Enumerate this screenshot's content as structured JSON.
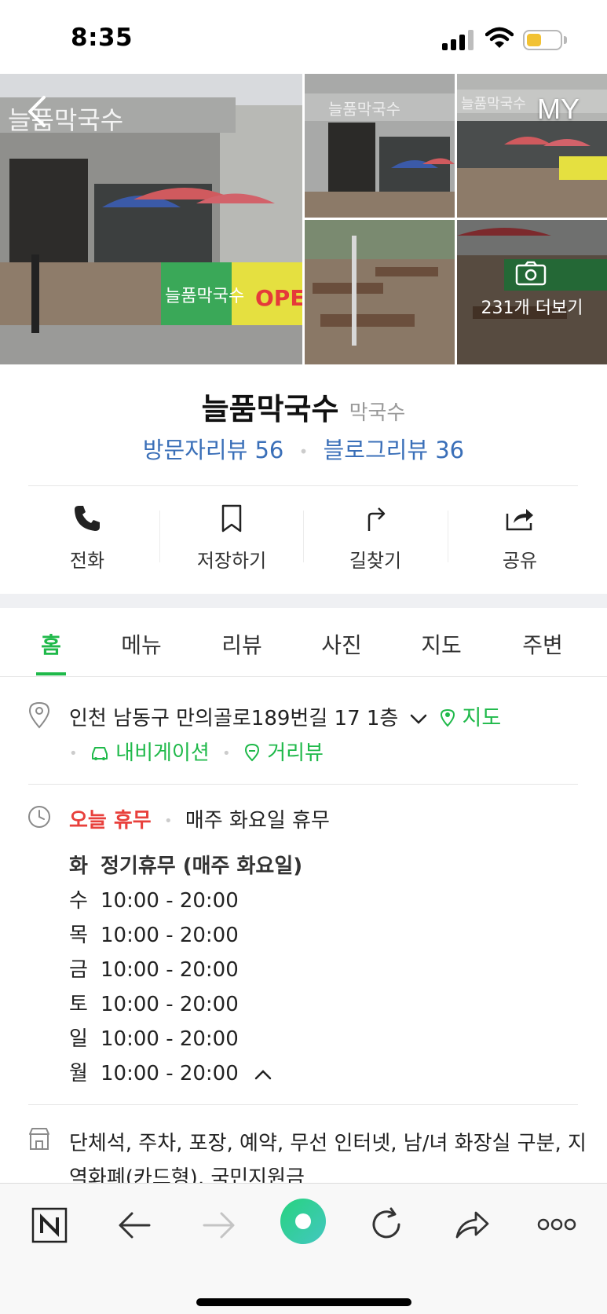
{
  "status_bar": {
    "time": "8:35",
    "battery_level": 0.45,
    "battery_color": "#f2c233",
    "icons": [
      "signal-icon",
      "wifi-icon",
      "battery-icon"
    ]
  },
  "header": {
    "back_icon": "chevron-left-icon",
    "my_label": "MY"
  },
  "photos": {
    "more_label": "231개 더보기",
    "more_icon": "camera-icon"
  },
  "place": {
    "name": "늘품막국수",
    "category": "막국수",
    "visitor_reviews": "방문자리뷰 56",
    "blog_reviews": "블로그리뷰 36"
  },
  "actions": [
    {
      "label": "전화",
      "icon": "phone-icon"
    },
    {
      "label": "저장하기",
      "icon": "bookmark-icon"
    },
    {
      "label": "길찾기",
      "icon": "directions-icon"
    },
    {
      "label": "공유",
      "icon": "share-icon"
    }
  ],
  "tabs": [
    {
      "label": "홈",
      "active": true
    },
    {
      "label": "메뉴",
      "active": false
    },
    {
      "label": "리뷰",
      "active": false
    },
    {
      "label": "사진",
      "active": false
    },
    {
      "label": "지도",
      "active": false
    },
    {
      "label": "주변",
      "active": false
    }
  ],
  "address": {
    "text": "인천 남동구 만의골로189번길 17 1층",
    "map_link": "지도",
    "navigation_link": "내비게이션",
    "street_view_link": "거리뷰"
  },
  "hours": {
    "status": "오늘 휴무",
    "note": "매주 화요일 휴무",
    "rows": [
      {
        "day": "화",
        "time": "정기휴무 (매주 화요일)"
      },
      {
        "day": "수",
        "time": "10:00 - 20:00"
      },
      {
        "day": "목",
        "time": "10:00 - 20:00"
      },
      {
        "day": "금",
        "time": "10:00 - 20:00"
      },
      {
        "day": "토",
        "time": "10:00 - 20:00"
      },
      {
        "day": "일",
        "time": "10:00 - 20:00"
      },
      {
        "day": "월",
        "time": "10:00 - 20:00"
      }
    ]
  },
  "facilities": {
    "text": "단체석, 주차, 포장, 예약, 무선 인터넷, 남/녀 화장실 구분, 지역화폐(카드형), 국민지원금"
  },
  "colors": {
    "accent_green": "#1fb94a",
    "review_blue": "#3a6fb8",
    "closed_red": "#e8403c"
  },
  "bottom_bar": {
    "icons": [
      "naver-home-icon",
      "back-arrow-icon",
      "forward-arrow-icon",
      "green-dot-icon",
      "refresh-icon",
      "share-arrow-icon",
      "more-icon"
    ]
  }
}
